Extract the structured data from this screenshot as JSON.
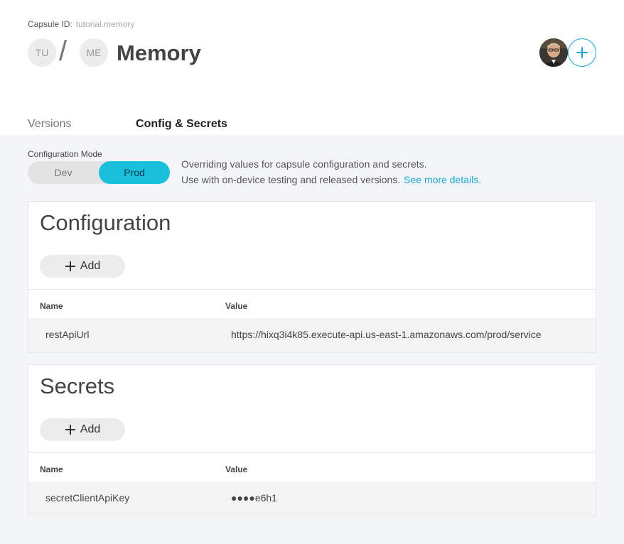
{
  "capsule": {
    "id_label": "Capsule ID:",
    "id_value": "tutorial.memory"
  },
  "breadcrumb": {
    "first": "TU",
    "separator": "/",
    "second": "ME"
  },
  "page_title": "Memory",
  "tabs": [
    {
      "label": "Versions",
      "active": false
    },
    {
      "label": "Config & Secrets",
      "active": true
    }
  ],
  "config_mode": {
    "label": "Configuration Mode",
    "options": [
      "Dev",
      "Prod"
    ],
    "selected": "Prod",
    "description_line1": "Overriding values for capsule configuration and secrets.",
    "description_line2": "Use with on-device testing and released versions.",
    "details_link": "See more details."
  },
  "configuration": {
    "title": "Configuration",
    "add_label": "Add",
    "columns": [
      "Name",
      "Value"
    ],
    "rows": [
      {
        "name": "restApiUrl",
        "value": "https://hixq3i4k85.execute-api.us-east-1.amazonaws.com/prod/service"
      }
    ]
  },
  "secrets": {
    "title": "Secrets",
    "add_label": "Add",
    "columns": [
      "Name",
      "Value"
    ],
    "rows": [
      {
        "name": "secretClientApiKey",
        "value": "●●●●e6h1"
      }
    ]
  },
  "colors": {
    "accent": "#19a6d3",
    "toggle_active": "#19c0dc",
    "content_bg": "#f3f5f8"
  },
  "icons": {
    "add_member": "plus-circle-icon",
    "add": "plus-icon"
  }
}
